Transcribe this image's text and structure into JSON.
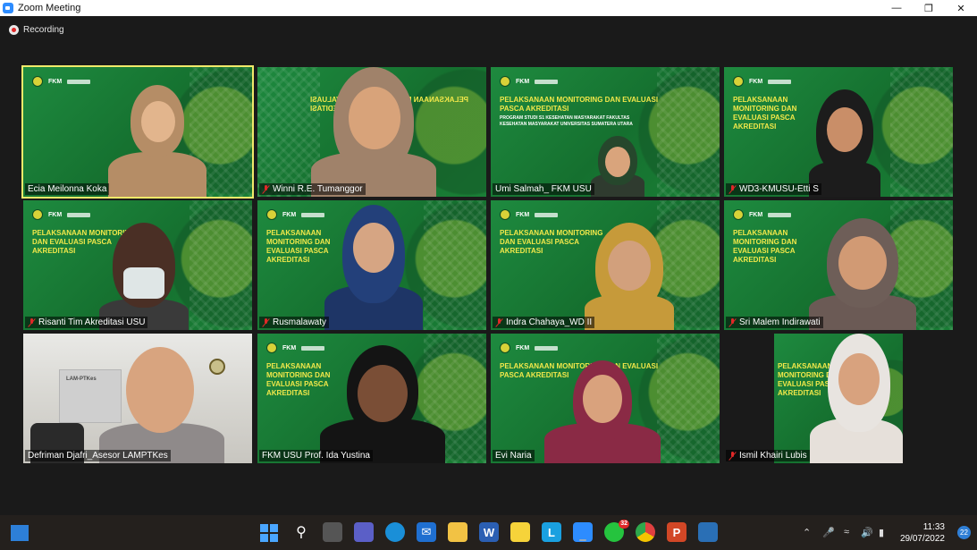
{
  "window": {
    "title": "Zoom Meeting",
    "minimize": "—",
    "maximize": "❐",
    "close": "✕"
  },
  "recording": {
    "label": "Recording"
  },
  "slide": {
    "brand": "FKM",
    "title": "PELAKSANAAN MONITORING DAN EVALUASI PASCA AKREDITASI",
    "subtitle": "PROGRAM STUDI S1 KESEHATAN MASYARAKAT FAKULTAS KESEHATAN MASYARAKAT UNIVERSITAS SUMATERA UTARA"
  },
  "participants": [
    {
      "name": "Ecia Meilonna Koka",
      "muted": false,
      "active": true
    },
    {
      "name": "Winni R.E. Tumanggor",
      "muted": true,
      "active": false
    },
    {
      "name": "Umi Salmah_ FKM USU",
      "muted": false,
      "active": false
    },
    {
      "name": "WD3-KMUSU-Etti S",
      "muted": true,
      "active": false
    },
    {
      "name": "Risanti Tim Akreditasi USU",
      "muted": true,
      "active": false
    },
    {
      "name": "Rusmalawaty",
      "muted": true,
      "active": false
    },
    {
      "name": "Indra Chahaya_WD II",
      "muted": true,
      "active": false
    },
    {
      "name": "Sri Malem Indirawati",
      "muted": true,
      "active": false
    },
    {
      "name": "Defriman Djafri_Asesor LAMPTKes",
      "muted": false,
      "active": false
    },
    {
      "name": "FKM USU Prof. Ida Yustina",
      "muted": false,
      "active": false
    },
    {
      "name": "Evi Naria",
      "muted": false,
      "active": false
    },
    {
      "name": "Ismil Khairi Lubis",
      "muted": true,
      "active": false
    }
  ],
  "room_sign": "LAM-PTKes",
  "taskbar": {
    "whatsapp_badge": "32",
    "chrome_badge": "",
    "time": "11:33",
    "date": "29/07/2022",
    "notifications": "22"
  }
}
